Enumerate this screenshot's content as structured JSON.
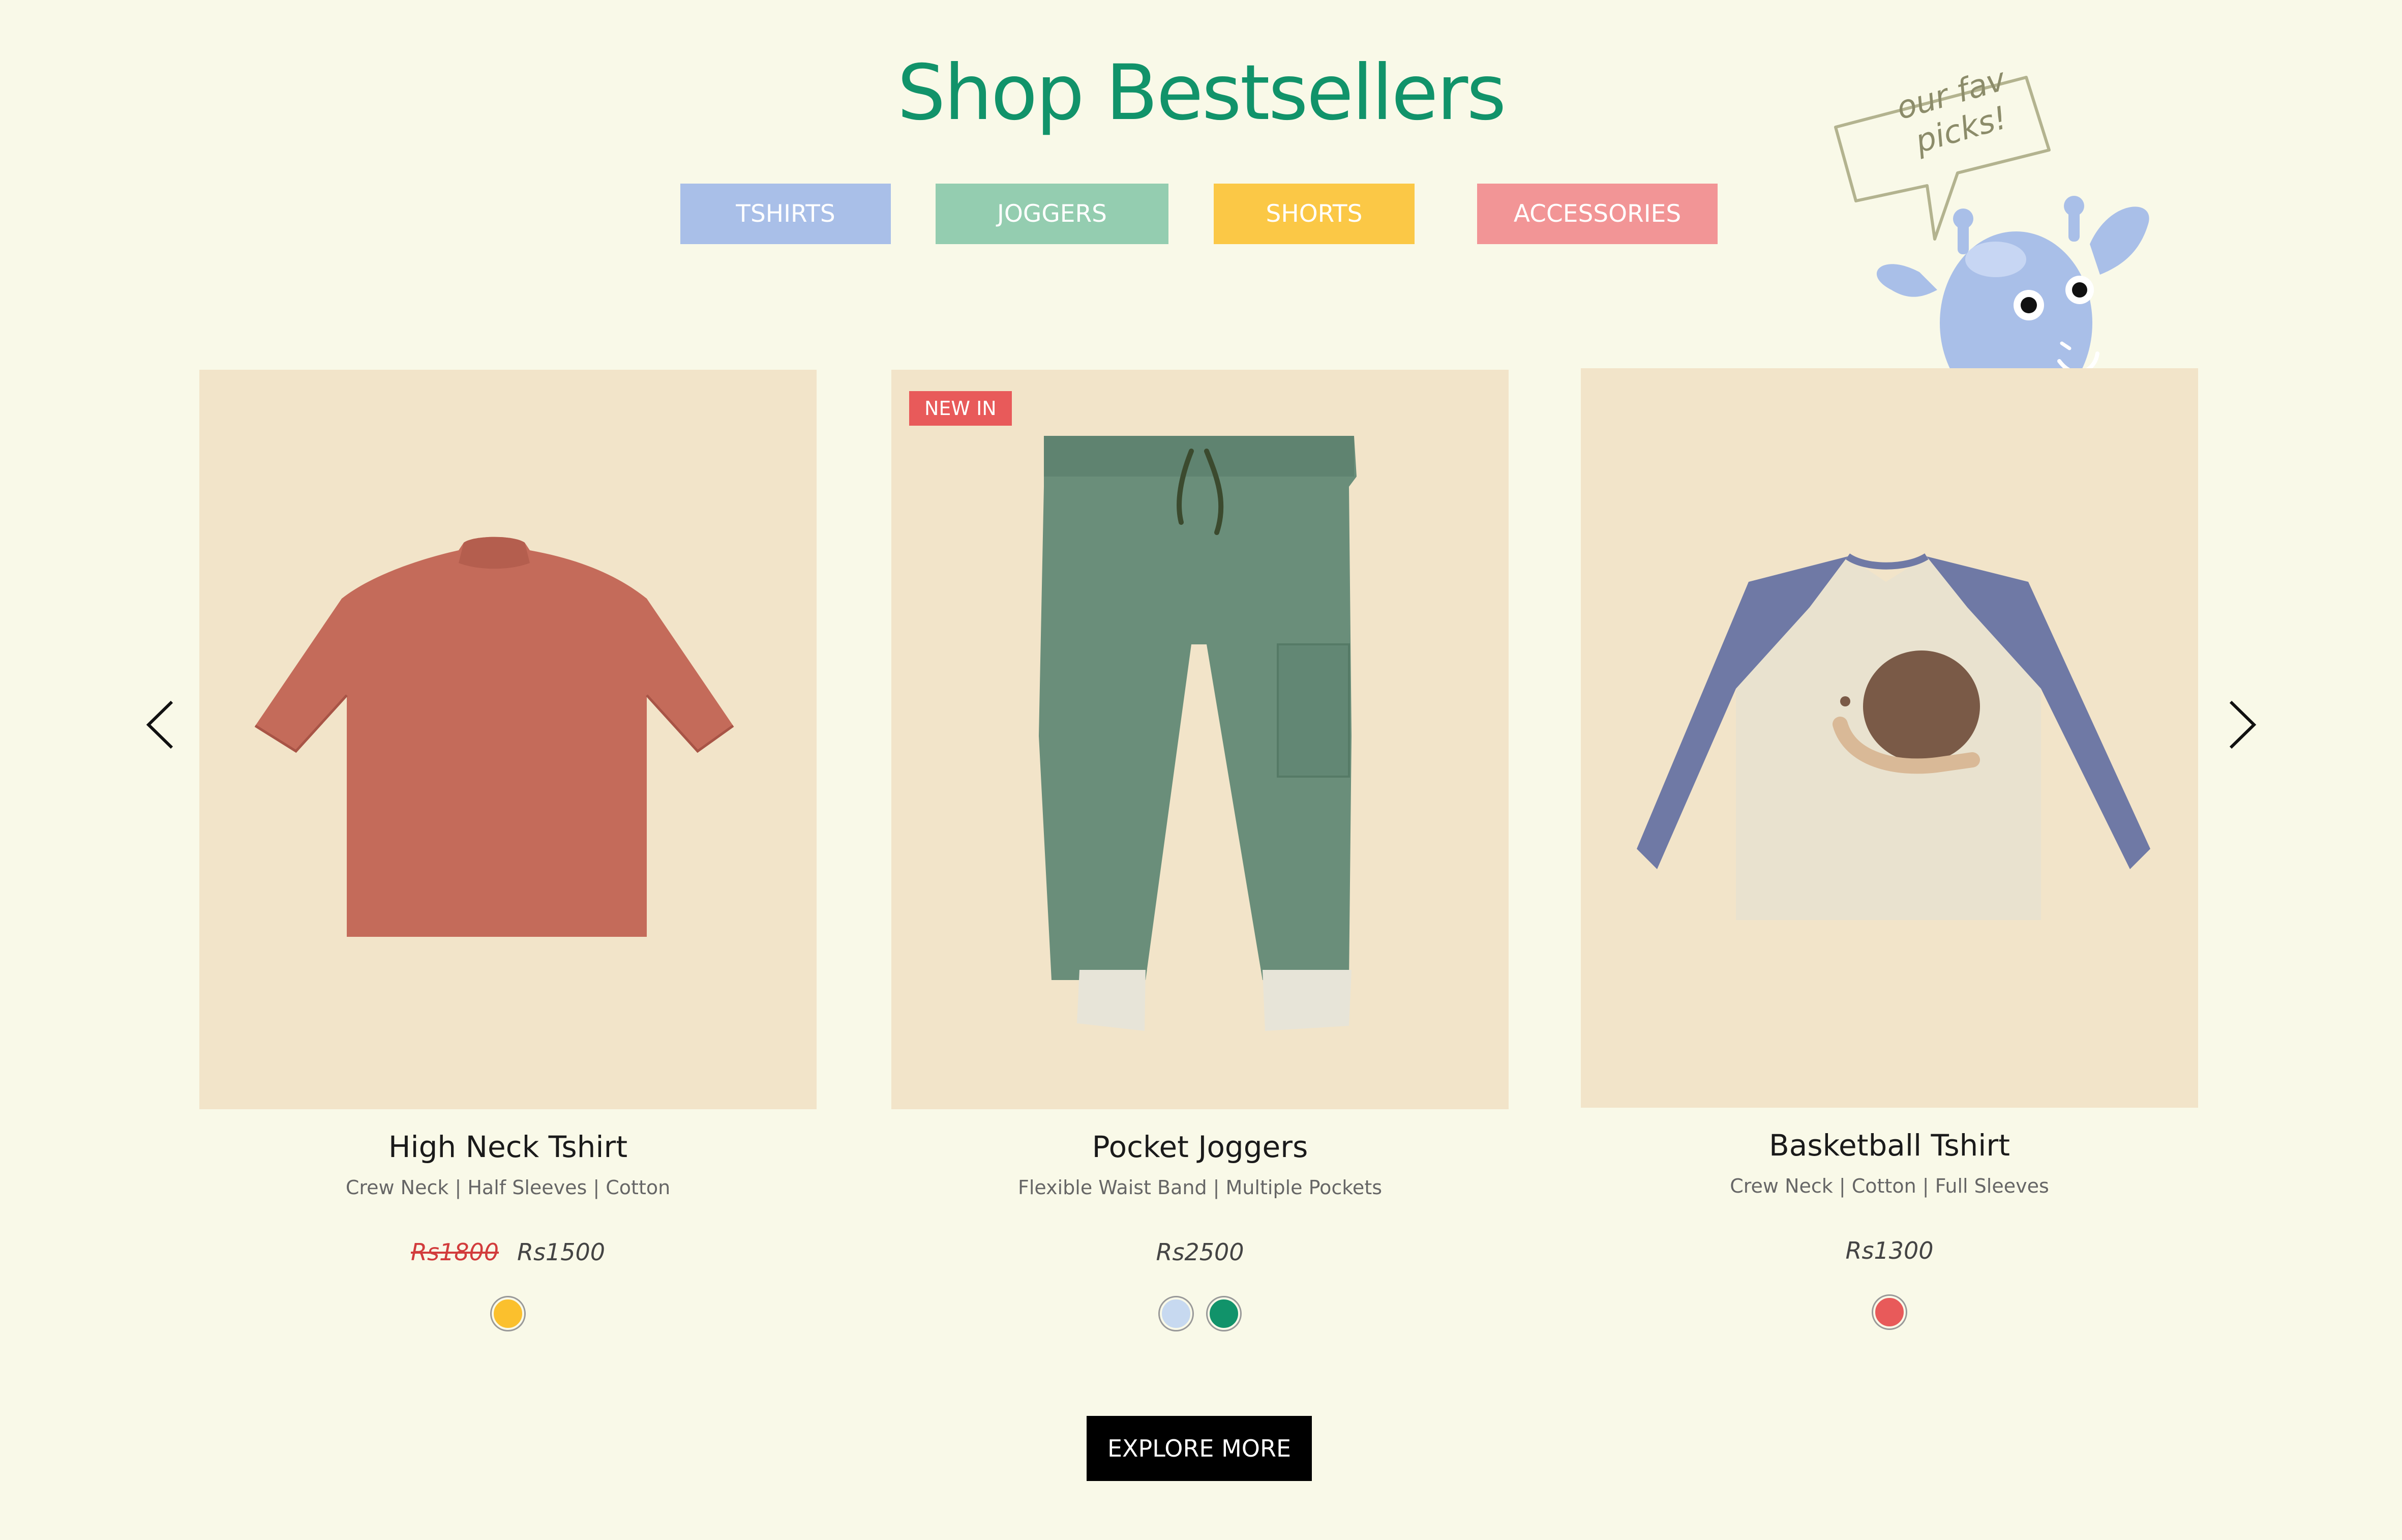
{
  "section": {
    "title": "Shop Bestsellers",
    "callout": "our fav picks!"
  },
  "categories": [
    {
      "label": "TSHIRTS",
      "color": "#a9bfe8"
    },
    {
      "label": "JOGGERS",
      "color": "#94cdb0"
    },
    {
      "label": "SHORTS",
      "color": "#fbc846"
    },
    {
      "label": "ACCESSORIES",
      "color": "#f29596"
    }
  ],
  "products": [
    {
      "name": "High Neck Tshirt",
      "features": "Crew Neck | Half Sleeves | Cotton",
      "old_price": "Rs1800",
      "price": "Rs1500",
      "badge": "",
      "swatches": [
        "#fbc02d"
      ],
      "image_icon": "red-tshirt-image"
    },
    {
      "name": "Pocket Joggers",
      "features": "Flexible Waist Band | Multiple Pockets",
      "old_price": "",
      "price": "Rs2500",
      "badge": "NEW IN",
      "swatches": [
        "#c7d9f0",
        "#11936a"
      ],
      "image_icon": "green-joggers-image"
    },
    {
      "name": "Basketball Tshirt",
      "features": "Crew Neck | Cotton | Full Sleeves",
      "old_price": "",
      "price": "Rs1300",
      "badge": "",
      "swatches": [
        "#e85a5a"
      ],
      "image_icon": "raglan-tshirt-image"
    }
  ],
  "carousel": {
    "prev_icon": "chevron-left-icon",
    "next_icon": "chevron-right-icon"
  },
  "explore": {
    "label": "EXPLORE MORE"
  },
  "colors": {
    "background": "#f9f9e8",
    "accent": "#11936a",
    "card_bg": "#f2e4c9",
    "badge": "#e85a5a"
  }
}
